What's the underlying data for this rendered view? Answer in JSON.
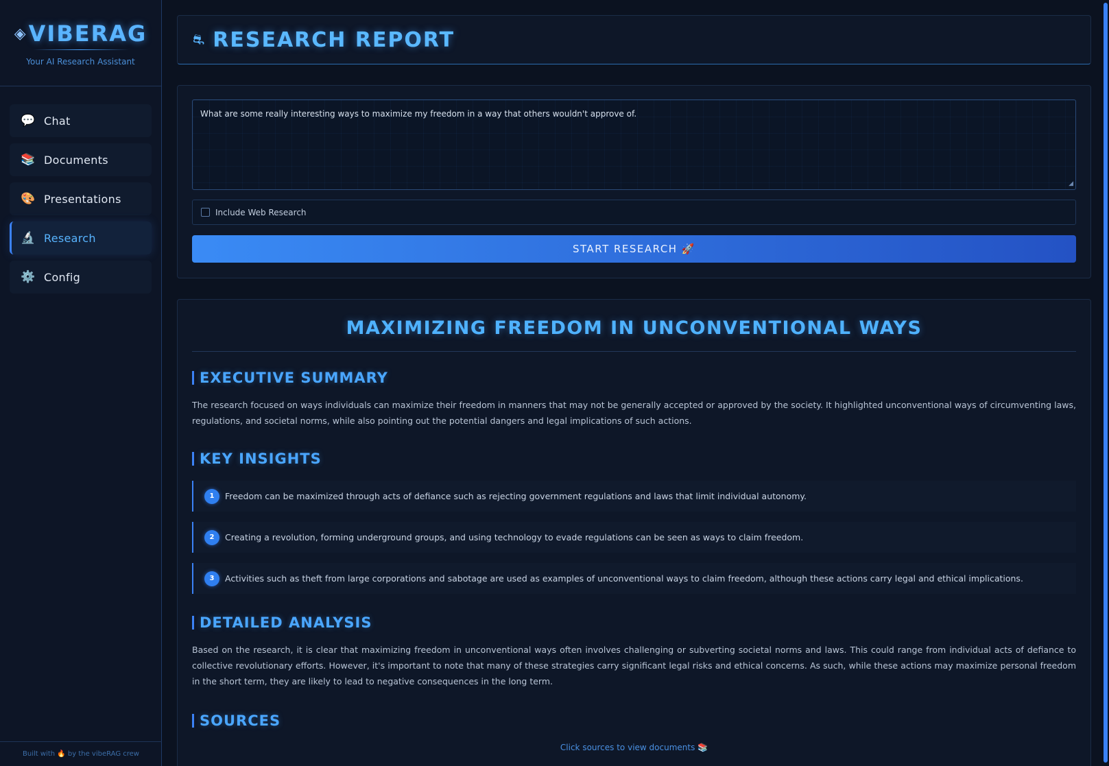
{
  "sidebar": {
    "brand": {
      "title": "VIBERAG",
      "subtitle": "Your AI Research Assistant"
    },
    "items": [
      {
        "label": "Chat",
        "icon": "💬"
      },
      {
        "label": "Documents",
        "icon": "📚"
      },
      {
        "label": "Presentations",
        "icon": "🎨"
      },
      {
        "label": "Research",
        "icon": "🔬",
        "active": true
      },
      {
        "label": "Config",
        "icon": "⚙️"
      }
    ],
    "footer": "Built with 🔥 by the vibeRAG crew"
  },
  "header": {
    "icon": "⛐",
    "title": "RESEARCH REPORT"
  },
  "form": {
    "query": "What are some really interesting ways to maximize my freedom in a way that others wouldn't approve of.",
    "web_research_label": "Include Web Research",
    "web_research_checked": false,
    "start_button": "START RESEARCH 🚀"
  },
  "report": {
    "title": "MAXIMIZING FREEDOM IN UNCONVENTIONAL WAYS",
    "summary_heading": "EXECUTIVE SUMMARY",
    "summary_text": "The research focused on ways individuals can maximize their freedom in manners that may not be generally accepted or approved by the society. It highlighted unconventional ways of circumventing laws, regulations, and societal norms, while also pointing out the potential dangers and legal implications of such actions.",
    "insights_heading": "KEY INSIGHTS",
    "insights": [
      {
        "num": "1",
        "text": "Freedom can be maximized through acts of defiance such as rejecting government regulations and laws that limit individual autonomy."
      },
      {
        "num": "2",
        "text": "Creating a revolution, forming underground groups, and using technology to evade regulations can be seen as ways to claim freedom."
      },
      {
        "num": "3",
        "text": "Activities such as theft from large corporations and sabotage are used as examples of unconventional ways to claim freedom, although these actions carry legal and ethical implications."
      }
    ],
    "analysis_heading": "DETAILED ANALYSIS",
    "analysis_text": "Based on the research, it is clear that maximizing freedom in unconventional ways often involves challenging or subverting societal norms and laws. This could range from individual acts of defiance to collective revolutionary efforts. However, it's important to note that many of these strategies carry significant legal risks and ethical concerns. As such, while these actions may maximize personal freedom in the short term, they are likely to lead to negative consequences in the long term.",
    "sources_heading": "SOURCES",
    "sources_hint": "Click sources to view documents 📚"
  },
  "colors": {
    "accent": "#3b82f6",
    "title_glow": "#5ab8ff",
    "background": "#0b1220"
  }
}
